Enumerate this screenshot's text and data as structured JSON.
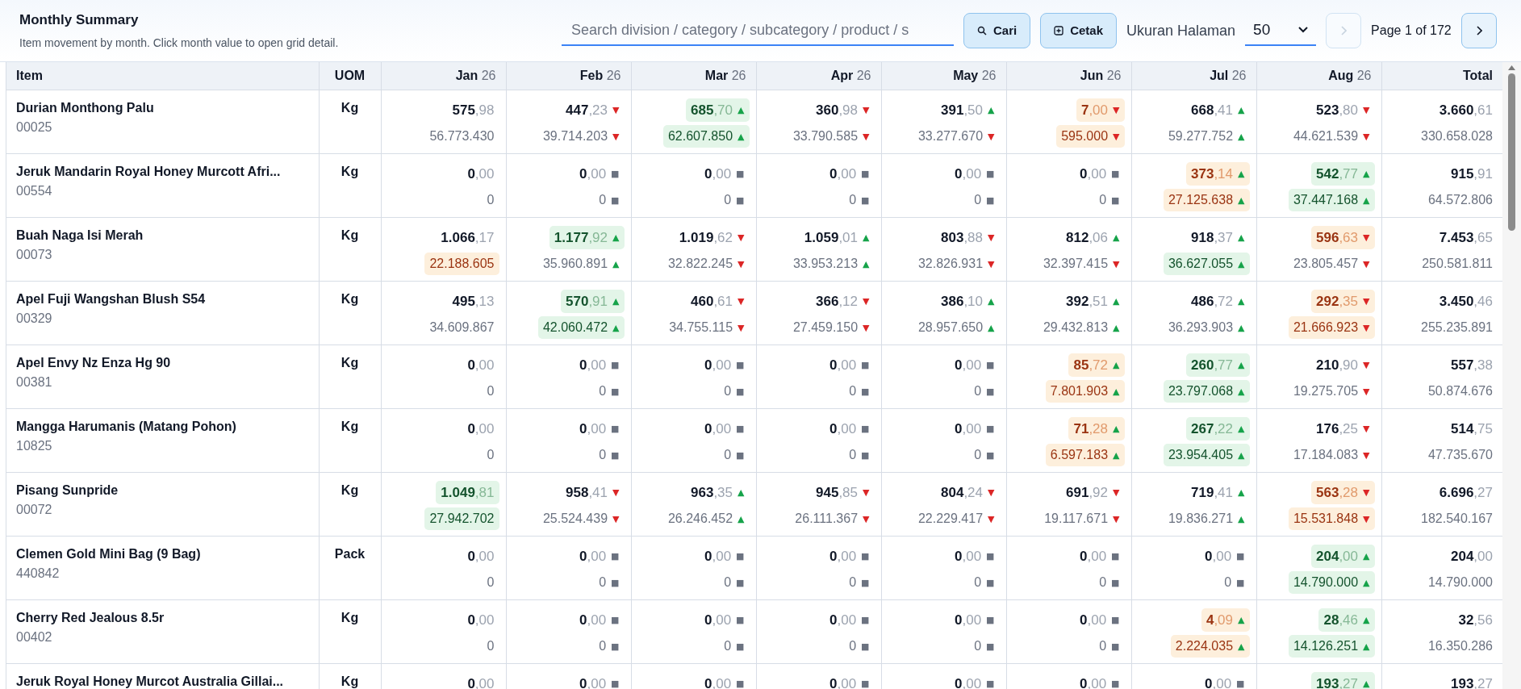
{
  "header": {
    "title": "Monthly Summary",
    "subtitle": "Item movement by month. Click month value to open grid detail."
  },
  "toolbar": {
    "search_placeholder": "Search division / category / subcategory / product / s",
    "search_button": "Cari",
    "print_button": "Cetak",
    "page_size_label": "Ukuran Halaman",
    "page_size": "50",
    "prev_disabled": true,
    "next_disabled": false,
    "page_info": "Page 1 of 172"
  },
  "table": {
    "columns": {
      "item": "Item",
      "uom": "UOM",
      "total": "Total"
    },
    "months": [
      {
        "month": "Jan",
        "year": "26"
      },
      {
        "month": "Feb",
        "year": "26"
      },
      {
        "month": "Mar",
        "year": "26"
      },
      {
        "month": "Apr",
        "year": "26"
      },
      {
        "month": "May",
        "year": "26"
      },
      {
        "month": "Jun",
        "year": "26"
      },
      {
        "month": "Jul",
        "year": "26"
      },
      {
        "month": "Aug",
        "year": "26"
      }
    ],
    "rows": [
      {
        "name": "Durian Monthong Palu",
        "code": "00025",
        "uom": "Kg",
        "cells": [
          {
            "quantity": {
              "whole": "575",
              "fraction": ",98"
            },
            "amount": {
              "text": "56.773.430"
            }
          },
          {
            "quantity": {
              "whole": "447",
              "fraction": ",23",
              "marker": {
                "symbol": "▼",
                "color": "#dc2626"
              }
            },
            "amount": {
              "text": "39.714.203",
              "marker": {
                "symbol": "▼",
                "color": "#dc2626"
              }
            }
          },
          {
            "quantity": {
              "whole": "685",
              "fraction": ",70",
              "color": "#e3f5e8",
              "marker": {
                "symbol": "▲",
                "color": "#16a34a"
              }
            },
            "amount": {
              "text": "62.607.850",
              "color": "#e3f5e8",
              "marker": {
                "symbol": "▲",
                "color": "#16a34a"
              }
            }
          },
          {
            "quantity": {
              "whole": "360",
              "fraction": ",98",
              "marker": {
                "symbol": "▼",
                "color": "#dc2626"
              }
            },
            "amount": {
              "text": "33.790.585",
              "marker": {
                "symbol": "▼",
                "color": "#dc2626"
              }
            }
          },
          {
            "quantity": {
              "whole": "391",
              "fraction": ",50",
              "marker": {
                "symbol": "▲",
                "color": "#16a34a"
              }
            },
            "amount": {
              "text": "33.277.670",
              "marker": {
                "symbol": "▼",
                "color": "#dc2626"
              }
            }
          },
          {
            "quantity": {
              "whole": "7",
              "fraction": ",00",
              "color": "#fdefdc",
              "marker": {
                "symbol": "▼",
                "color": "#dc2626"
              }
            },
            "amount": {
              "text": "595.000",
              "color": "#fdefdc",
              "marker": {
                "symbol": "▼",
                "color": "#dc2626"
              }
            }
          },
          {
            "quantity": {
              "whole": "668",
              "fraction": ",41",
              "marker": {
                "symbol": "▲",
                "color": "#16a34a"
              }
            },
            "amount": {
              "text": "59.277.752",
              "marker": {
                "symbol": "▲",
                "color": "#16a34a"
              }
            }
          },
          {
            "quantity": {
              "whole": "523",
              "fraction": ",80",
              "marker": {
                "symbol": "▼",
                "color": "#dc2626"
              }
            },
            "amount": {
              "text": "44.621.539",
              "marker": {
                "symbol": "▼",
                "color": "#dc2626"
              }
            }
          }
        ],
        "total": {
          "whole": "3.660",
          "fraction": ",61",
          "amount": "330.658.028"
        }
      },
      {
        "name": "Jeruk Mandarin Royal Honey Murcott Afri...",
        "code": "00554",
        "uom": "Kg",
        "cells": [
          {
            "quantity": {
              "whole": "0",
              "fraction": ",00"
            },
            "amount": {
              "text": "0"
            }
          },
          {
            "quantity": {
              "whole": "0",
              "fraction": ",00",
              "marker": {
                "symbol": "■",
                "color": "#6b7280"
              }
            },
            "amount": {
              "text": "0",
              "marker": {
                "symbol": "■",
                "color": "#6b7280"
              }
            }
          },
          {
            "quantity": {
              "whole": "0",
              "fraction": ",00",
              "marker": {
                "symbol": "■",
                "color": "#6b7280"
              }
            },
            "amount": {
              "text": "0",
              "marker": {
                "symbol": "■",
                "color": "#6b7280"
              }
            }
          },
          {
            "quantity": {
              "whole": "0",
              "fraction": ",00",
              "marker": {
                "symbol": "■",
                "color": "#6b7280"
              }
            },
            "amount": {
              "text": "0",
              "marker": {
                "symbol": "■",
                "color": "#6b7280"
              }
            }
          },
          {
            "quantity": {
              "whole": "0",
              "fraction": ",00",
              "marker": {
                "symbol": "■",
                "color": "#6b7280"
              }
            },
            "amount": {
              "text": "0",
              "marker": {
                "symbol": "■",
                "color": "#6b7280"
              }
            }
          },
          {
            "quantity": {
              "whole": "0",
              "fraction": ",00",
              "marker": {
                "symbol": "■",
                "color": "#6b7280"
              }
            },
            "amount": {
              "text": "0",
              "marker": {
                "symbol": "■",
                "color": "#6b7280"
              }
            }
          },
          {
            "quantity": {
              "whole": "373",
              "fraction": ",14",
              "color": "#fdefdc",
              "marker": {
                "symbol": "▲",
                "color": "#16a34a"
              }
            },
            "amount": {
              "text": "27.125.638",
              "color": "#fdefdc",
              "marker": {
                "symbol": "▲",
                "color": "#16a34a"
              }
            }
          },
          {
            "quantity": {
              "whole": "542",
              "fraction": ",77",
              "color": "#e3f5e8",
              "marker": {
                "symbol": "▲",
                "color": "#16a34a"
              }
            },
            "amount": {
              "text": "37.447.168",
              "color": "#e3f5e8",
              "marker": {
                "symbol": "▲",
                "color": "#16a34a"
              }
            }
          }
        ],
        "total": {
          "whole": "915",
          "fraction": ",91",
          "amount": "64.572.806"
        }
      },
      {
        "name": "Buah Naga Isi Merah",
        "code": "00073",
        "uom": "Kg",
        "cells": [
          {
            "quantity": {
              "whole": "1.066",
              "fraction": ",17"
            },
            "amount": {
              "text": "22.188.605",
              "color": "#fdefdc"
            }
          },
          {
            "quantity": {
              "whole": "1.177",
              "fraction": ",92",
              "color": "#e3f5e8",
              "marker": {
                "symbol": "▲",
                "color": "#16a34a"
              }
            },
            "amount": {
              "text": "35.960.891",
              "marker": {
                "symbol": "▲",
                "color": "#16a34a"
              }
            }
          },
          {
            "quantity": {
              "whole": "1.019",
              "fraction": ",62",
              "marker": {
                "symbol": "▼",
                "color": "#dc2626"
              }
            },
            "amount": {
              "text": "32.822.245",
              "marker": {
                "symbol": "▼",
                "color": "#dc2626"
              }
            }
          },
          {
            "quantity": {
              "whole": "1.059",
              "fraction": ",01",
              "marker": {
                "symbol": "▲",
                "color": "#16a34a"
              }
            },
            "amount": {
              "text": "33.953.213",
              "marker": {
                "symbol": "▲",
                "color": "#16a34a"
              }
            }
          },
          {
            "quantity": {
              "whole": "803",
              "fraction": ",88",
              "marker": {
                "symbol": "▼",
                "color": "#dc2626"
              }
            },
            "amount": {
              "text": "32.826.931",
              "marker": {
                "symbol": "▼",
                "color": "#dc2626"
              }
            }
          },
          {
            "quantity": {
              "whole": "812",
              "fraction": ",06",
              "marker": {
                "symbol": "▲",
                "color": "#16a34a"
              }
            },
            "amount": {
              "text": "32.397.415",
              "marker": {
                "symbol": "▼",
                "color": "#dc2626"
              }
            }
          },
          {
            "quantity": {
              "whole": "918",
              "fraction": ",37",
              "marker": {
                "symbol": "▲",
                "color": "#16a34a"
              }
            },
            "amount": {
              "text": "36.627.055",
              "color": "#e3f5e8",
              "marker": {
                "symbol": "▲",
                "color": "#16a34a"
              }
            }
          },
          {
            "quantity": {
              "whole": "596",
              "fraction": ",63",
              "color": "#fdefdc",
              "marker": {
                "symbol": "▼",
                "color": "#dc2626"
              }
            },
            "amount": {
              "text": "23.805.457",
              "marker": {
                "symbol": "▼",
                "color": "#dc2626"
              }
            }
          }
        ],
        "total": {
          "whole": "7.453",
          "fraction": ",65",
          "amount": "250.581.811"
        }
      },
      {
        "name": "Apel Fuji Wangshan Blush S54",
        "code": "00329",
        "uom": "Kg",
        "cells": [
          {
            "quantity": {
              "whole": "495",
              "fraction": ",13"
            },
            "amount": {
              "text": "34.609.867"
            }
          },
          {
            "quantity": {
              "whole": "570",
              "fraction": ",91",
              "color": "#e3f5e8",
              "marker": {
                "symbol": "▲",
                "color": "#16a34a"
              }
            },
            "amount": {
              "text": "42.060.472",
              "color": "#e3f5e8",
              "marker": {
                "symbol": "▲",
                "color": "#16a34a"
              }
            }
          },
          {
            "quantity": {
              "whole": "460",
              "fraction": ",61",
              "marker": {
                "symbol": "▼",
                "color": "#dc2626"
              }
            },
            "amount": {
              "text": "34.755.115",
              "marker": {
                "symbol": "▼",
                "color": "#dc2626"
              }
            }
          },
          {
            "quantity": {
              "whole": "366",
              "fraction": ",12",
              "marker": {
                "symbol": "▼",
                "color": "#dc2626"
              }
            },
            "amount": {
              "text": "27.459.150",
              "marker": {
                "symbol": "▼",
                "color": "#dc2626"
              }
            }
          },
          {
            "quantity": {
              "whole": "386",
              "fraction": ",10",
              "marker": {
                "symbol": "▲",
                "color": "#16a34a"
              }
            },
            "amount": {
              "text": "28.957.650",
              "marker": {
                "symbol": "▲",
                "color": "#16a34a"
              }
            }
          },
          {
            "quantity": {
              "whole": "392",
              "fraction": ",51",
              "marker": {
                "symbol": "▲",
                "color": "#16a34a"
              }
            },
            "amount": {
              "text": "29.432.813",
              "marker": {
                "symbol": "▲",
                "color": "#16a34a"
              }
            }
          },
          {
            "quantity": {
              "whole": "486",
              "fraction": ",72",
              "marker": {
                "symbol": "▲",
                "color": "#16a34a"
              }
            },
            "amount": {
              "text": "36.293.903",
              "marker": {
                "symbol": "▲",
                "color": "#16a34a"
              }
            }
          },
          {
            "quantity": {
              "whole": "292",
              "fraction": ",35",
              "color": "#fdefdc",
              "marker": {
                "symbol": "▼",
                "color": "#dc2626"
              }
            },
            "amount": {
              "text": "21.666.923",
              "color": "#fdefdc",
              "marker": {
                "symbol": "▼",
                "color": "#dc2626"
              }
            }
          }
        ],
        "total": {
          "whole": "3.450",
          "fraction": ",46",
          "amount": "255.235.891"
        }
      },
      {
        "name": "Apel Envy Nz Enza Hg 90",
        "code": "00381",
        "uom": "Kg",
        "cells": [
          {
            "quantity": {
              "whole": "0",
              "fraction": ",00"
            },
            "amount": {
              "text": "0"
            }
          },
          {
            "quantity": {
              "whole": "0",
              "fraction": ",00",
              "marker": {
                "symbol": "■",
                "color": "#6b7280"
              }
            },
            "amount": {
              "text": "0",
              "marker": {
                "symbol": "■",
                "color": "#6b7280"
              }
            }
          },
          {
            "quantity": {
              "whole": "0",
              "fraction": ",00",
              "marker": {
                "symbol": "■",
                "color": "#6b7280"
              }
            },
            "amount": {
              "text": "0",
              "marker": {
                "symbol": "■",
                "color": "#6b7280"
              }
            }
          },
          {
            "quantity": {
              "whole": "0",
              "fraction": ",00",
              "marker": {
                "symbol": "■",
                "color": "#6b7280"
              }
            },
            "amount": {
              "text": "0",
              "marker": {
                "symbol": "■",
                "color": "#6b7280"
              }
            }
          },
          {
            "quantity": {
              "whole": "0",
              "fraction": ",00",
              "marker": {
                "symbol": "■",
                "color": "#6b7280"
              }
            },
            "amount": {
              "text": "0",
              "marker": {
                "symbol": "■",
                "color": "#6b7280"
              }
            }
          },
          {
            "quantity": {
              "whole": "85",
              "fraction": ",72",
              "color": "#fdefdc",
              "marker": {
                "symbol": "▲",
                "color": "#16a34a"
              }
            },
            "amount": {
              "text": "7.801.903",
              "color": "#fdefdc",
              "marker": {
                "symbol": "▲",
                "color": "#16a34a"
              }
            }
          },
          {
            "quantity": {
              "whole": "260",
              "fraction": ",77",
              "color": "#e3f5e8",
              "marker": {
                "symbol": "▲",
                "color": "#16a34a"
              }
            },
            "amount": {
              "text": "23.797.068",
              "color": "#e3f5e8",
              "marker": {
                "symbol": "▲",
                "color": "#16a34a"
              }
            }
          },
          {
            "quantity": {
              "whole": "210",
              "fraction": ",90",
              "marker": {
                "symbol": "▼",
                "color": "#dc2626"
              }
            },
            "amount": {
              "text": "19.275.705",
              "marker": {
                "symbol": "▼",
                "color": "#dc2626"
              }
            }
          }
        ],
        "total": {
          "whole": "557",
          "fraction": ",38",
          "amount": "50.874.676"
        }
      },
      {
        "name": "Mangga Harumanis (Matang Pohon)",
        "code": "10825",
        "uom": "Kg",
        "cells": [
          {
            "quantity": {
              "whole": "0",
              "fraction": ",00"
            },
            "amount": {
              "text": "0"
            }
          },
          {
            "quantity": {
              "whole": "0",
              "fraction": ",00",
              "marker": {
                "symbol": "■",
                "color": "#6b7280"
              }
            },
            "amount": {
              "text": "0",
              "marker": {
                "symbol": "■",
                "color": "#6b7280"
              }
            }
          },
          {
            "quantity": {
              "whole": "0",
              "fraction": ",00",
              "marker": {
                "symbol": "■",
                "color": "#6b7280"
              }
            },
            "amount": {
              "text": "0",
              "marker": {
                "symbol": "■",
                "color": "#6b7280"
              }
            }
          },
          {
            "quantity": {
              "whole": "0",
              "fraction": ",00",
              "marker": {
                "symbol": "■",
                "color": "#6b7280"
              }
            },
            "amount": {
              "text": "0",
              "marker": {
                "symbol": "■",
                "color": "#6b7280"
              }
            }
          },
          {
            "quantity": {
              "whole": "0",
              "fraction": ",00",
              "marker": {
                "symbol": "■",
                "color": "#6b7280"
              }
            },
            "amount": {
              "text": "0",
              "marker": {
                "symbol": "■",
                "color": "#6b7280"
              }
            }
          },
          {
            "quantity": {
              "whole": "71",
              "fraction": ",28",
              "color": "#fdefdc",
              "marker": {
                "symbol": "▲",
                "color": "#16a34a"
              }
            },
            "amount": {
              "text": "6.597.183",
              "color": "#fdefdc",
              "marker": {
                "symbol": "▲",
                "color": "#16a34a"
              }
            }
          },
          {
            "quantity": {
              "whole": "267",
              "fraction": ",22",
              "color": "#e3f5e8",
              "marker": {
                "symbol": "▲",
                "color": "#16a34a"
              }
            },
            "amount": {
              "text": "23.954.405",
              "color": "#e3f5e8",
              "marker": {
                "symbol": "▲",
                "color": "#16a34a"
              }
            }
          },
          {
            "quantity": {
              "whole": "176",
              "fraction": ",25",
              "marker": {
                "symbol": "▼",
                "color": "#dc2626"
              }
            },
            "amount": {
              "text": "17.184.083",
              "marker": {
                "symbol": "▼",
                "color": "#dc2626"
              }
            }
          }
        ],
        "total": {
          "whole": "514",
          "fraction": ",75",
          "amount": "47.735.670"
        }
      },
      {
        "name": "Pisang Sunpride",
        "code": "00072",
        "uom": "Kg",
        "cells": [
          {
            "quantity": {
              "whole": "1.049",
              "fraction": ",81",
              "color": "#e3f5e8"
            },
            "amount": {
              "text": "27.942.702",
              "color": "#e3f5e8"
            }
          },
          {
            "quantity": {
              "whole": "958",
              "fraction": ",41",
              "marker": {
                "symbol": "▼",
                "color": "#dc2626"
              }
            },
            "amount": {
              "text": "25.524.439",
              "marker": {
                "symbol": "▼",
                "color": "#dc2626"
              }
            }
          },
          {
            "quantity": {
              "whole": "963",
              "fraction": ",35",
              "marker": {
                "symbol": "▲",
                "color": "#16a34a"
              }
            },
            "amount": {
              "text": "26.246.452",
              "marker": {
                "symbol": "▲",
                "color": "#16a34a"
              }
            }
          },
          {
            "quantity": {
              "whole": "945",
              "fraction": ",85",
              "marker": {
                "symbol": "▼",
                "color": "#dc2626"
              }
            },
            "amount": {
              "text": "26.111.367",
              "marker": {
                "symbol": "▼",
                "color": "#dc2626"
              }
            }
          },
          {
            "quantity": {
              "whole": "804",
              "fraction": ",24",
              "marker": {
                "symbol": "▼",
                "color": "#dc2626"
              }
            },
            "amount": {
              "text": "22.229.417",
              "marker": {
                "symbol": "▼",
                "color": "#dc2626"
              }
            }
          },
          {
            "quantity": {
              "whole": "691",
              "fraction": ",92",
              "marker": {
                "symbol": "▼",
                "color": "#dc2626"
              }
            },
            "amount": {
              "text": "19.117.671",
              "marker": {
                "symbol": "▼",
                "color": "#dc2626"
              }
            }
          },
          {
            "quantity": {
              "whole": "719",
              "fraction": ",41",
              "marker": {
                "symbol": "▲",
                "color": "#16a34a"
              }
            },
            "amount": {
              "text": "19.836.271",
              "marker": {
                "symbol": "▲",
                "color": "#16a34a"
              }
            }
          },
          {
            "quantity": {
              "whole": "563",
              "fraction": ",28",
              "color": "#fdefdc",
              "marker": {
                "symbol": "▼",
                "color": "#dc2626"
              }
            },
            "amount": {
              "text": "15.531.848",
              "color": "#fdefdc",
              "marker": {
                "symbol": "▼",
                "color": "#dc2626"
              }
            }
          }
        ],
        "total": {
          "whole": "6.696",
          "fraction": ",27",
          "amount": "182.540.167"
        }
      },
      {
        "name": "Clemen Gold Mini Bag (9 Bag)",
        "code": "440842",
        "uom": "Pack",
        "cells": [
          {
            "quantity": {
              "whole": "0",
              "fraction": ",00"
            },
            "amount": {
              "text": "0"
            }
          },
          {
            "quantity": {
              "whole": "0",
              "fraction": ",00",
              "marker": {
                "symbol": "■",
                "color": "#6b7280"
              }
            },
            "amount": {
              "text": "0",
              "marker": {
                "symbol": "■",
                "color": "#6b7280"
              }
            }
          },
          {
            "quantity": {
              "whole": "0",
              "fraction": ",00",
              "marker": {
                "symbol": "■",
                "color": "#6b7280"
              }
            },
            "amount": {
              "text": "0",
              "marker": {
                "symbol": "■",
                "color": "#6b7280"
              }
            }
          },
          {
            "quantity": {
              "whole": "0",
              "fraction": ",00",
              "marker": {
                "symbol": "■",
                "color": "#6b7280"
              }
            },
            "amount": {
              "text": "0",
              "marker": {
                "symbol": "■",
                "color": "#6b7280"
              }
            }
          },
          {
            "quantity": {
              "whole": "0",
              "fraction": ",00",
              "marker": {
                "symbol": "■",
                "color": "#6b7280"
              }
            },
            "amount": {
              "text": "0",
              "marker": {
                "symbol": "■",
                "color": "#6b7280"
              }
            }
          },
          {
            "quantity": {
              "whole": "0",
              "fraction": ",00",
              "marker": {
                "symbol": "■",
                "color": "#6b7280"
              }
            },
            "amount": {
              "text": "0",
              "marker": {
                "symbol": "■",
                "color": "#6b7280"
              }
            }
          },
          {
            "quantity": {
              "whole": "0",
              "fraction": ",00",
              "marker": {
                "symbol": "■",
                "color": "#6b7280"
              }
            },
            "amount": {
              "text": "0",
              "marker": {
                "symbol": "■",
                "color": "#6b7280"
              }
            }
          },
          {
            "quantity": {
              "whole": "204",
              "fraction": ",00",
              "color": "#e3f5e8",
              "marker": {
                "symbol": "▲",
                "color": "#16a34a"
              }
            },
            "amount": {
              "text": "14.790.000",
              "color": "#e3f5e8",
              "marker": {
                "symbol": "▲",
                "color": "#16a34a"
              }
            }
          }
        ],
        "total": {
          "whole": "204",
          "fraction": ",00",
          "amount": "14.790.000"
        }
      },
      {
        "name": "Cherry Red Jealous 8.5r",
        "code": "00402",
        "uom": "Kg",
        "cells": [
          {
            "quantity": {
              "whole": "0",
              "fraction": ",00"
            },
            "amount": {
              "text": "0"
            }
          },
          {
            "quantity": {
              "whole": "0",
              "fraction": ",00",
              "marker": {
                "symbol": "■",
                "color": "#6b7280"
              }
            },
            "amount": {
              "text": "0",
              "marker": {
                "symbol": "■",
                "color": "#6b7280"
              }
            }
          },
          {
            "quantity": {
              "whole": "0",
              "fraction": ",00",
              "marker": {
                "symbol": "■",
                "color": "#6b7280"
              }
            },
            "amount": {
              "text": "0",
              "marker": {
                "symbol": "■",
                "color": "#6b7280"
              }
            }
          },
          {
            "quantity": {
              "whole": "0",
              "fraction": ",00",
              "marker": {
                "symbol": "■",
                "color": "#6b7280"
              }
            },
            "amount": {
              "text": "0",
              "marker": {
                "symbol": "■",
                "color": "#6b7280"
              }
            }
          },
          {
            "quantity": {
              "whole": "0",
              "fraction": ",00",
              "marker": {
                "symbol": "■",
                "color": "#6b7280"
              }
            },
            "amount": {
              "text": "0",
              "marker": {
                "symbol": "■",
                "color": "#6b7280"
              }
            }
          },
          {
            "quantity": {
              "whole": "0",
              "fraction": ",00",
              "marker": {
                "symbol": "■",
                "color": "#6b7280"
              }
            },
            "amount": {
              "text": "0",
              "marker": {
                "symbol": "■",
                "color": "#6b7280"
              }
            }
          },
          {
            "quantity": {
              "whole": "4",
              "fraction": ",09",
              "color": "#fdefdc",
              "marker": {
                "symbol": "▲",
                "color": "#16a34a"
              }
            },
            "amount": {
              "text": "2.224.035",
              "color": "#fdefdc",
              "marker": {
                "symbol": "▲",
                "color": "#16a34a"
              }
            }
          },
          {
            "quantity": {
              "whole": "28",
              "fraction": ",46",
              "color": "#e3f5e8",
              "marker": {
                "symbol": "▲",
                "color": "#16a34a"
              }
            },
            "amount": {
              "text": "14.126.251",
              "color": "#e3f5e8",
              "marker": {
                "symbol": "▲",
                "color": "#16a34a"
              }
            }
          }
        ],
        "total": {
          "whole": "32",
          "fraction": ",56",
          "amount": "16.350.286"
        }
      },
      {
        "name": "Jeruk Royal Honey Murcot Australia Gillai...",
        "uom": "Kg",
        "cells": [
          {
            "quantity": {
              "whole": "0",
              "fraction": ",00"
            }
          },
          {
            "quantity": {
              "whole": "0",
              "fraction": ",00",
              "marker": {
                "symbol": "■",
                "color": "#6b7280"
              }
            }
          },
          {
            "quantity": {
              "whole": "0",
              "fraction": ",00",
              "marker": {
                "symbol": "■",
                "color": "#6b7280"
              }
            }
          },
          {
            "quantity": {
              "whole": "0",
              "fraction": ",00",
              "marker": {
                "symbol": "■",
                "color": "#6b7280"
              }
            }
          },
          {
            "quantity": {
              "whole": "0",
              "fraction": ",00",
              "marker": {
                "symbol": "■",
                "color": "#6b7280"
              }
            }
          },
          {
            "quantity": {
              "whole": "0",
              "fraction": ",00",
              "marker": {
                "symbol": "■",
                "color": "#6b7280"
              }
            }
          },
          {
            "quantity": {
              "whole": "0",
              "fraction": ",00",
              "marker": {
                "symbol": "■",
                "color": "#6b7280"
              }
            }
          },
          {
            "quantity": {
              "whole": "193",
              "fraction": ",27",
              "color": "#e3f5e8",
              "marker": {
                "symbol": "▲",
                "color": "#16a34a"
              }
            }
          }
        ],
        "total": {
          "whole": "193",
          "fraction": ",27"
        }
      }
    ]
  }
}
